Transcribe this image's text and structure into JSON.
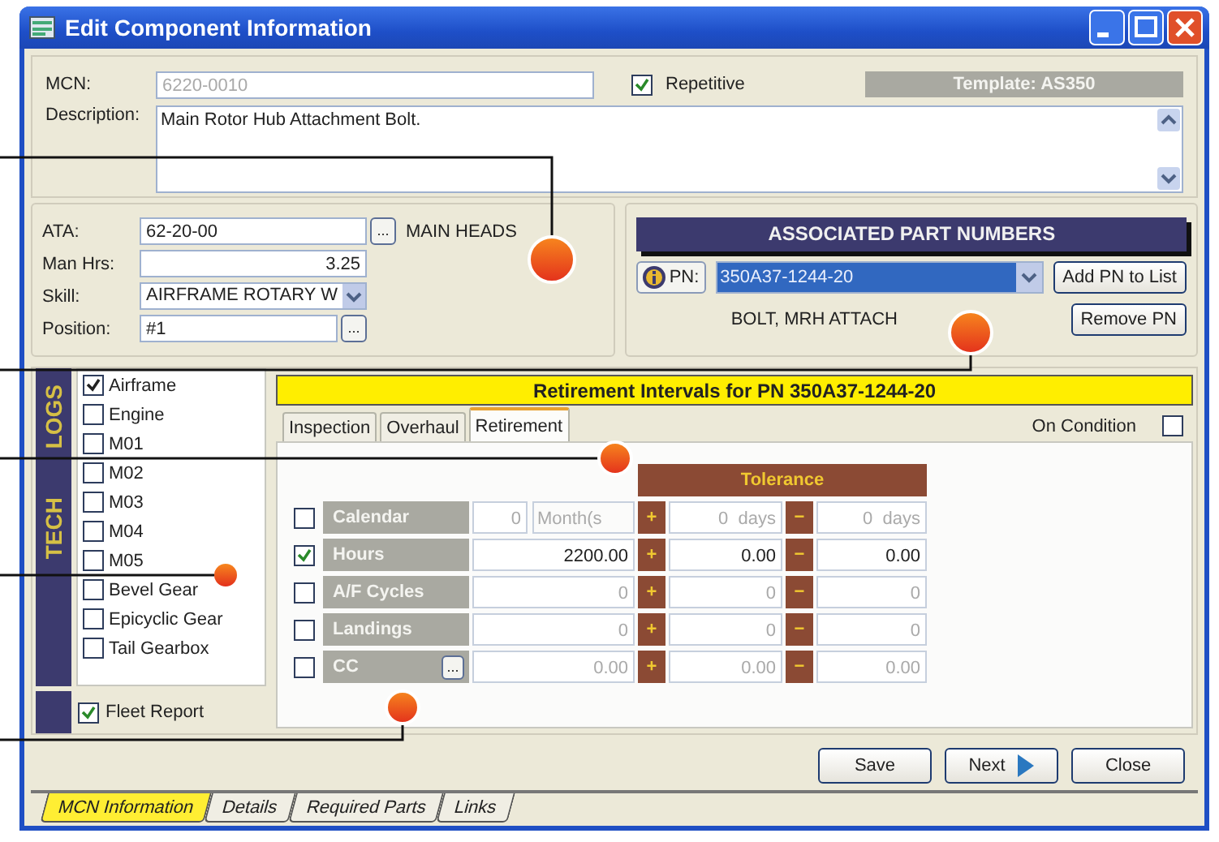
{
  "window": {
    "title": "Edit Component Information"
  },
  "header": {
    "mcn": {
      "label": "MCN:",
      "value": "6220-0010",
      "disabled": true
    },
    "repetitive": {
      "label": "Repetitive",
      "checked": true
    },
    "template": "Template: AS350",
    "description": {
      "label": "Description:",
      "value": "Main Rotor Hub Attachment Bolt."
    }
  },
  "details": {
    "ata": {
      "label": "ATA:",
      "value": "62-20-00",
      "browse": "...",
      "note": "MAIN HEADS"
    },
    "man_hrs": {
      "label": "Man Hrs:",
      "value": "3.25"
    },
    "skill": {
      "label": "Skill:",
      "value": "AIRFRAME ROTARY W"
    },
    "position": {
      "label": "Position:",
      "value": "#1",
      "browse": "..."
    }
  },
  "associated": {
    "title": "ASSOCIATED PART NUMBERS",
    "pn_label": "PN:",
    "pn_value": "350A37-1244-20",
    "pn_description": "BOLT, MRH ATTACH",
    "buttons": [
      "Add PN to List",
      "Remove PN"
    ]
  },
  "tech_logs": {
    "title": "TECH LOGS",
    "items": [
      {
        "label": "Airframe",
        "checked": true
      },
      {
        "label": "Engine",
        "checked": false
      },
      {
        "label": "M01",
        "checked": false
      },
      {
        "label": "M02",
        "checked": false
      },
      {
        "label": "M03",
        "checked": false
      },
      {
        "label": "M04",
        "checked": false
      },
      {
        "label": "M05",
        "checked": false
      },
      {
        "label": "Bevel Gear",
        "checked": false
      },
      {
        "label": "Epicyclic Gear",
        "checked": false
      },
      {
        "label": "Tail Gearbox",
        "checked": false
      }
    ],
    "fleet_report": {
      "label": "Fleet Report",
      "checked": true
    }
  },
  "intervals": {
    "header": "Retirement Intervals for PN 350A37-1244-20",
    "tabs": [
      {
        "label": "Inspection",
        "selected": false
      },
      {
        "label": "Overhaul",
        "selected": false
      },
      {
        "label": "Retirement",
        "selected": true
      }
    ],
    "on_condition": {
      "label": "On Condition",
      "checked": false
    },
    "tolerance": "Tolerance",
    "plus_sign": "+",
    "minus_sign": "−",
    "rows": [
      {
        "kind": "unit",
        "label": "Calendar",
        "checked": false,
        "value": "0",
        "unit": "Month(s",
        "plus": "0  days",
        "minus": "0  days"
      },
      {
        "kind": "plain",
        "label": "Hours",
        "checked": true,
        "value": "2200.00",
        "plus": "0.00",
        "minus": "0.00"
      },
      {
        "kind": "plain",
        "label": "A/F Cycles",
        "checked": false,
        "value": "0",
        "plus": "0",
        "minus": "0"
      },
      {
        "kind": "plain",
        "label": "Landings",
        "checked": false,
        "value": "0",
        "plus": "0",
        "minus": "0"
      },
      {
        "kind": "browse",
        "label": "CC",
        "checked": false,
        "browse": "...",
        "value": "0.00",
        "plus": "0.00",
        "minus": "0.00"
      }
    ]
  },
  "buttons": [
    "Save",
    "Next",
    "Close"
  ],
  "bottom_tabs": [
    {
      "label": "MCN Information",
      "selected": true
    },
    {
      "label": "Details",
      "selected": false
    },
    {
      "label": "Required Parts",
      "selected": false
    },
    {
      "label": "Links",
      "selected": false
    }
  ]
}
